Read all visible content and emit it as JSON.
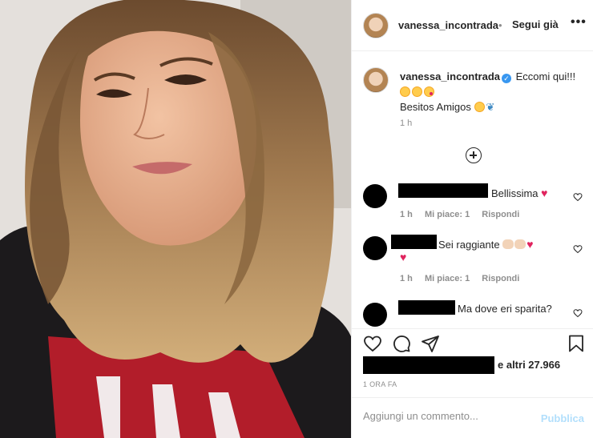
{
  "post": {
    "username": "vanessa_incontrada",
    "header_separator": "•",
    "follow_label": "Segui già",
    "more_label": "•••",
    "caption_line1": "Eccomi qui!!!",
    "caption_line2": "Besitos Amigos",
    "caption_time": "1 h",
    "likes_text": "e altri 27.966",
    "post_time": "1 ORA FA"
  },
  "comments": [
    {
      "text": "Bellissima",
      "time": "1 h",
      "likes": "Mi piace: 1",
      "reply": "Rispondi"
    },
    {
      "text": "Sei raggiante",
      "time": "1 h",
      "likes": "Mi piace: 1",
      "reply": "Rispondi"
    },
    {
      "text": "Ma dove eri sparita?"
    }
  ],
  "comment_box": {
    "placeholder": "Aggiungi un commento...",
    "publish_label": "Pubblica"
  },
  "icons": {
    "more": "more-icon",
    "verified": "verified-badge-icon",
    "load_more": "plus-circle-icon",
    "like": "heart-icon",
    "comment": "comment-icon",
    "share": "paper-plane-icon",
    "save": "bookmark-icon"
  },
  "colors": {
    "accent_blue": "#3897f0",
    "publish_disabled": "#b2dffc",
    "muted_text": "#8e8e8e",
    "heart_red": "#e0245e"
  }
}
